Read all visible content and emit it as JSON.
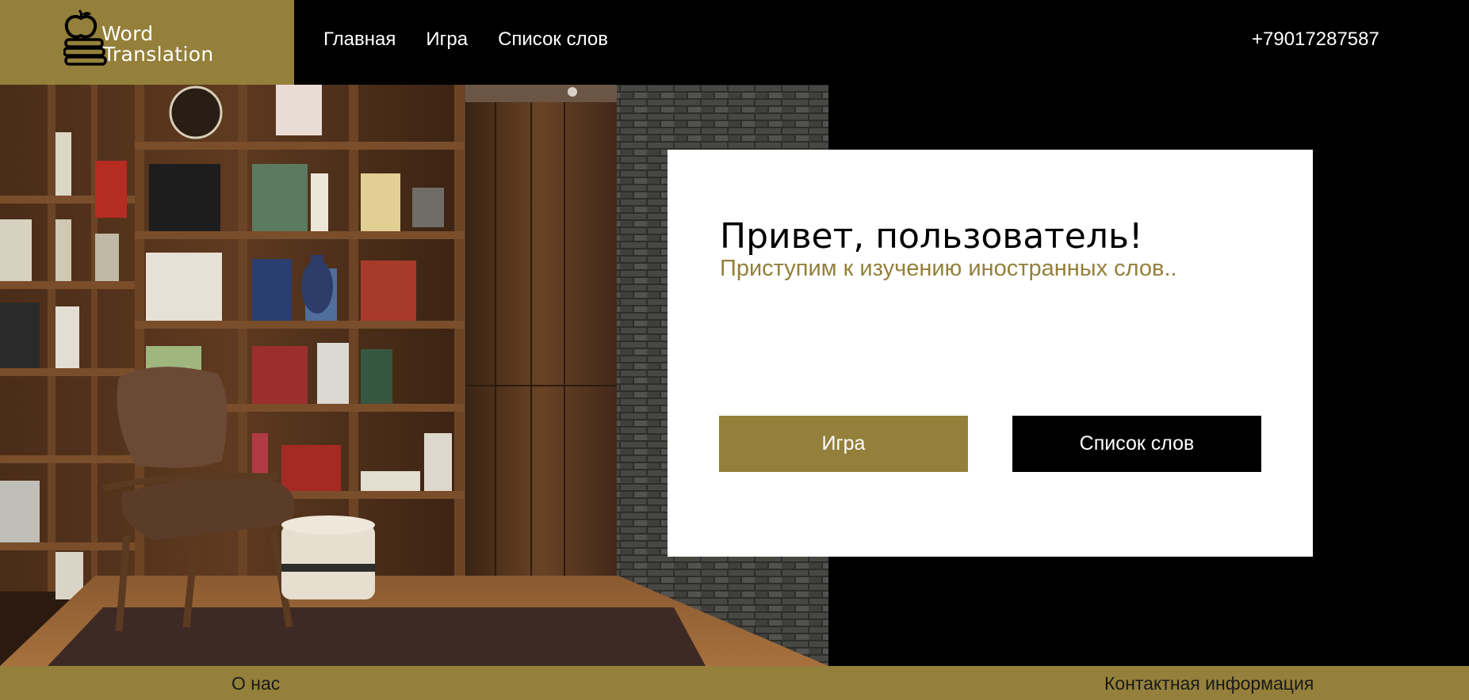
{
  "header": {
    "logo": {
      "line1": "Word",
      "line2": "Translation"
    },
    "nav": [
      {
        "label": "Главная"
      },
      {
        "label": "Игра"
      },
      {
        "label": "Список слов"
      }
    ],
    "phone": "+79017287587"
  },
  "hero_card": {
    "title": "Привет, пользователь!",
    "subtitle": "Приступим к изучению иностранных слов..",
    "buttons": {
      "game_label": "Игра",
      "words_label": "Список слов"
    }
  },
  "footer": {
    "about_label": "О нас",
    "contacts_label": "Контактная информация"
  },
  "colors": {
    "accent": "#94803a",
    "background": "#000000",
    "card": "#ffffff"
  }
}
